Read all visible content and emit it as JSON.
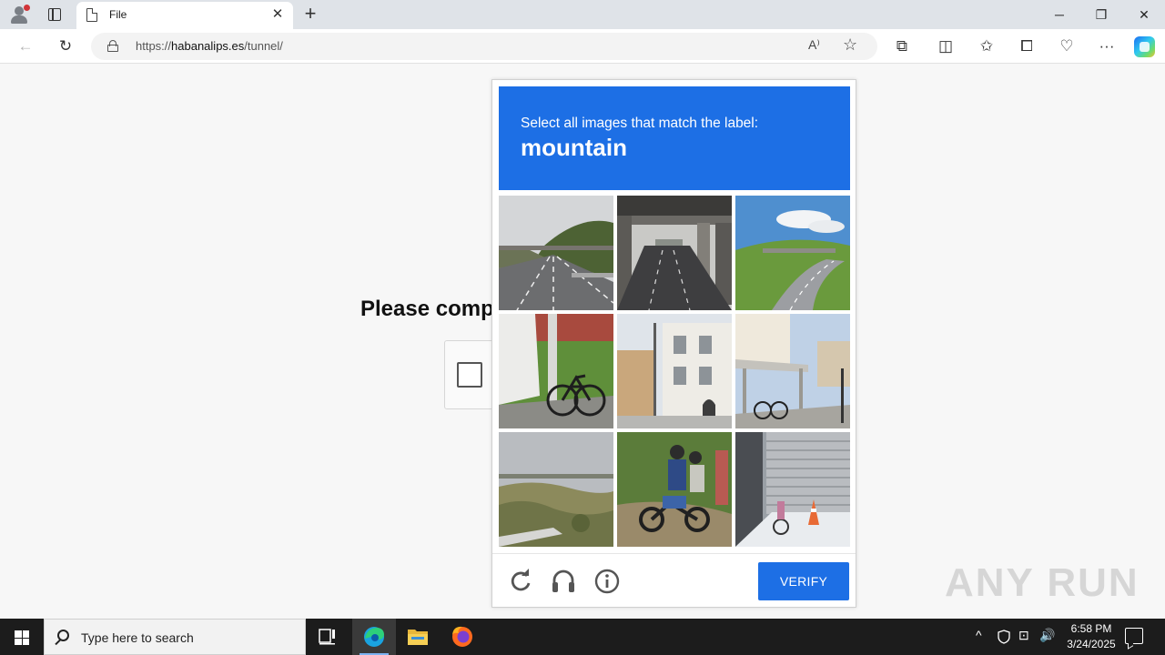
{
  "browser": {
    "tab": {
      "title": "File",
      "close_glyph": "✕"
    },
    "new_tab_glyph": "+",
    "window_controls": {
      "minimize": "─",
      "restore": "❐",
      "close": "✕"
    },
    "toolbar": {
      "back_glyph": "←",
      "refresh_glyph": "↻",
      "url_prefix": "https://",
      "url_domain": "habanalips.es",
      "url_path": "/tunnel/",
      "read_aloud_glyph": "A⁾",
      "favorite_glyph": "☆",
      "extensions_glyph": "⧉",
      "split_glyph": "◫",
      "favorites_glyph": "✩",
      "collections_glyph": "⧠",
      "performance_glyph": "♡",
      "more_glyph": "···"
    }
  },
  "page": {
    "prompt_text": "Please comp"
  },
  "captcha": {
    "instruction": "Select all images that match the label:",
    "label": "mountain",
    "verify_label": "VERIFY",
    "tiles": [
      "highway with overpass and wooded hill",
      "road under concrete overpass",
      "curving road with overpass and green hill",
      "bicycle leaning on pole beside car",
      "white building facade on city street",
      "bicycles parked under building awning",
      "dry grass field under hazy sky",
      "people riding motorcycle on dirt path",
      "metal shutter storefront with traffic cone"
    ],
    "footer_icons": [
      "refresh-icon",
      "audio-challenge-icon",
      "info-icon"
    ],
    "accent_color": "#1d6fe5"
  },
  "watermark": {
    "text": "ANY RUN"
  },
  "taskbar": {
    "search_placeholder": "Type here to search",
    "clock_time": "6:58 PM",
    "clock_date": "3/24/2025",
    "tray_chevron": "^",
    "tray_network": "⊡",
    "tray_volume": "🔊"
  }
}
